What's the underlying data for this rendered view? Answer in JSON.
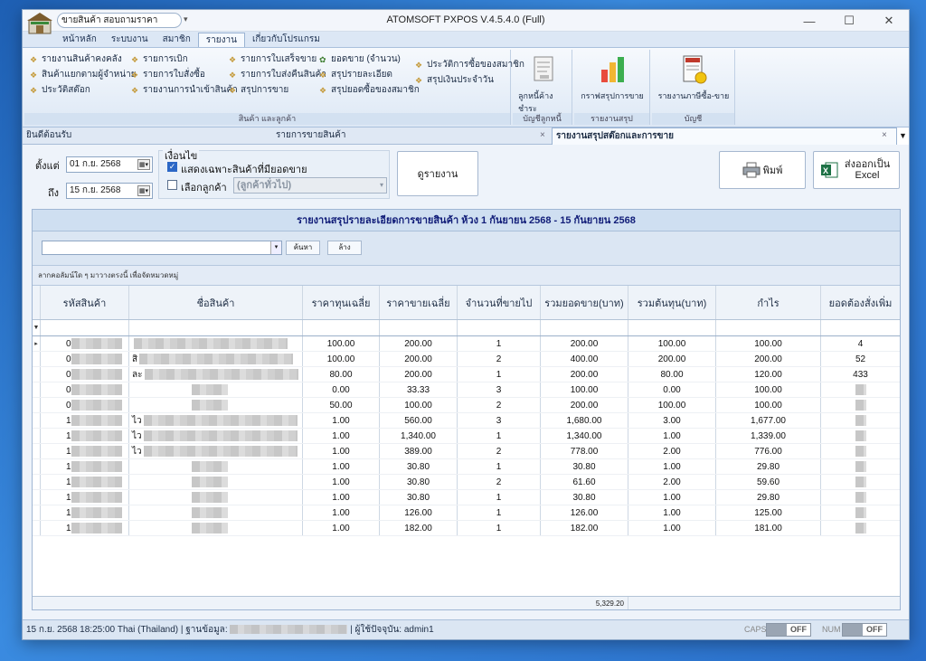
{
  "window": {
    "title": "ATOMSOFT PXPOS V.4.5.4.0 (Full)",
    "quick_access": "ขายสินค้า  สอบถามราคา",
    "minimize": "—",
    "maximize": "☐",
    "close": "✕"
  },
  "ribbon_tabs": [
    "หน้าหลัก",
    "ระบบงาน",
    "สมาชิก",
    "รายงาน",
    "เกี่ยวกับโปรแกรม"
  ],
  "ribbon": {
    "group_products": {
      "label": "สินค้า และลูกค้า",
      "col1": [
        "รายงานสินค้าคงคลัง",
        "สินค้าแยกตามผู้จำหน่าย",
        "ประวัติสต๊อก"
      ],
      "col2": [
        "รายการเบิก",
        "รายการใบสั่งซื้อ",
        "รายงานการนำเข้าสินค้า"
      ],
      "col3": [
        "รายการใบเสร็จขาย",
        "รายการใบส่งคืนสินค้า",
        "สรุปการขาย"
      ],
      "col4": [
        "ยอดขาย (จำนวน)",
        "สรุปรายละเอียด",
        "สรุปยอดซื้อของสมาชิก"
      ],
      "col5": [
        "ประวัติการซื้อของสมาชิก",
        "สรุปเงินประจำวัน"
      ]
    },
    "group_debt": {
      "label": "บัญชีลูกหนี้",
      "button": "ลูกหนี้ค้างชำระ"
    },
    "group_summary": {
      "label": "รายงานสรุป",
      "button": "กราฟสรุปการขาย"
    },
    "group_account": {
      "label": "บัญชี",
      "button": "รายงานภาษีซื้อ-ขาย"
    }
  },
  "doc_tabs": {
    "welcome": "ยินดีต้อนรับ",
    "sales_list": "รายการขายสินค้า",
    "active": "รายงานสรุปสต๊อกและการขาย",
    "close": "×"
  },
  "filter": {
    "from_label": "ตั้งแต่",
    "from_date": "01 ก.ย.   2568",
    "to_label": "ถึง",
    "to_date": "15 ก.ย.   2568",
    "condition_label": "เงื่อนไข",
    "only_sold_label": "แสดงเฉพาะสินค้าที่มียอดขาย",
    "only_sold_checked": true,
    "choose_customer_label": "เลือกลูกค้า",
    "customer_value": "(ลูกค้าทั่วไป)",
    "view_report_button": "ดูรายงาน",
    "print_button": "พิมพ์",
    "export_button": "ส่งออกเป็น Excel"
  },
  "report": {
    "title": "รายงานสรุปรายละเอียดการขายสินค้า  ห้วง 1 กันยายน 2568  -  15 กันยายน 2568",
    "search_button": "ค้นหา",
    "clear_button": "ล้าง",
    "group_hint": "ลากคอลัมน์ใด ๆ มาวางตรงนี้ เพื่อจัดหมวดหมู่",
    "columns": [
      "รหัสสินค้า",
      "ชื่อสินค้า",
      "ราคาทุนเฉลี่ย",
      "ราคาขายเฉลี่ย",
      "จำนวนที่ขายไป",
      "รวมยอดขาย(บาท)",
      "รวมต้นทุน(บาท)",
      "กำไร",
      "ยอดต้องสั่งเพิ่ม"
    ],
    "rows": [
      {
        "code": "0",
        "name": "",
        "cost": "100.00",
        "price": "200.00",
        "qty": "1",
        "sales": "200.00",
        "total_cost": "100.00",
        "profit": "100.00",
        "reorder": "4"
      },
      {
        "code": "0",
        "name": "สิ",
        "cost": "100.00",
        "price": "200.00",
        "qty": "2",
        "sales": "400.00",
        "total_cost": "200.00",
        "profit": "200.00",
        "reorder": "52"
      },
      {
        "code": "0",
        "name": "ละ",
        "cost": "80.00",
        "price": "200.00",
        "qty": "1",
        "sales": "200.00",
        "total_cost": "80.00",
        "profit": "120.00",
        "reorder": "433"
      },
      {
        "code": "0",
        "name": "",
        "cost": "0.00",
        "price": "33.33",
        "qty": "3",
        "sales": "100.00",
        "total_cost": "0.00",
        "profit": "100.00",
        "reorder": ""
      },
      {
        "code": "0",
        "name": "",
        "cost": "50.00",
        "price": "100.00",
        "qty": "2",
        "sales": "200.00",
        "total_cost": "100.00",
        "profit": "100.00",
        "reorder": ""
      },
      {
        "code": "1",
        "name": "ไว",
        "cost": "1.00",
        "price": "560.00",
        "qty": "3",
        "sales": "1,680.00",
        "total_cost": "3.00",
        "profit": "1,677.00",
        "reorder": ""
      },
      {
        "code": "1",
        "name": "ไว",
        "cost": "1.00",
        "price": "1,340.00",
        "qty": "1",
        "sales": "1,340.00",
        "total_cost": "1.00",
        "profit": "1,339.00",
        "reorder": ""
      },
      {
        "code": "1",
        "name": "ไว",
        "cost": "1.00",
        "price": "389.00",
        "qty": "2",
        "sales": "778.00",
        "total_cost": "2.00",
        "profit": "776.00",
        "reorder": ""
      },
      {
        "code": "1",
        "name": "",
        "cost": "1.00",
        "price": "30.80",
        "qty": "1",
        "sales": "30.80",
        "total_cost": "1.00",
        "profit": "29.80",
        "reorder": ""
      },
      {
        "code": "1",
        "name": "",
        "cost": "1.00",
        "price": "30.80",
        "qty": "2",
        "sales": "61.60",
        "total_cost": "2.00",
        "profit": "59.60",
        "reorder": ""
      },
      {
        "code": "1",
        "name": "",
        "cost": "1.00",
        "price": "30.80",
        "qty": "1",
        "sales": "30.80",
        "total_cost": "1.00",
        "profit": "29.80",
        "reorder": ""
      },
      {
        "code": "1",
        "name": "",
        "cost": "1.00",
        "price": "126.00",
        "qty": "1",
        "sales": "126.00",
        "total_cost": "1.00",
        "profit": "125.00",
        "reorder": ""
      },
      {
        "code": "1",
        "name": "",
        "cost": "1.00",
        "price": "182.00",
        "qty": "1",
        "sales": "182.00",
        "total_cost": "1.00",
        "profit": "181.00",
        "reorder": ""
      }
    ],
    "total_sales": "5,329.20"
  },
  "status": {
    "text_before": "15 ก.ย. 2568 18:25:00 Thai (Thailand)  |  ฐานข้อมูล: ",
    "text_after": " |  ผู้ใช้ปัจจุบัน: admin1",
    "caps_label": "CAPS",
    "caps_state": "OFF",
    "num_label": "NUM",
    "num_state": "OFF"
  },
  "colors": {
    "accent": "#2b67c6",
    "title_text": "#101c78"
  }
}
